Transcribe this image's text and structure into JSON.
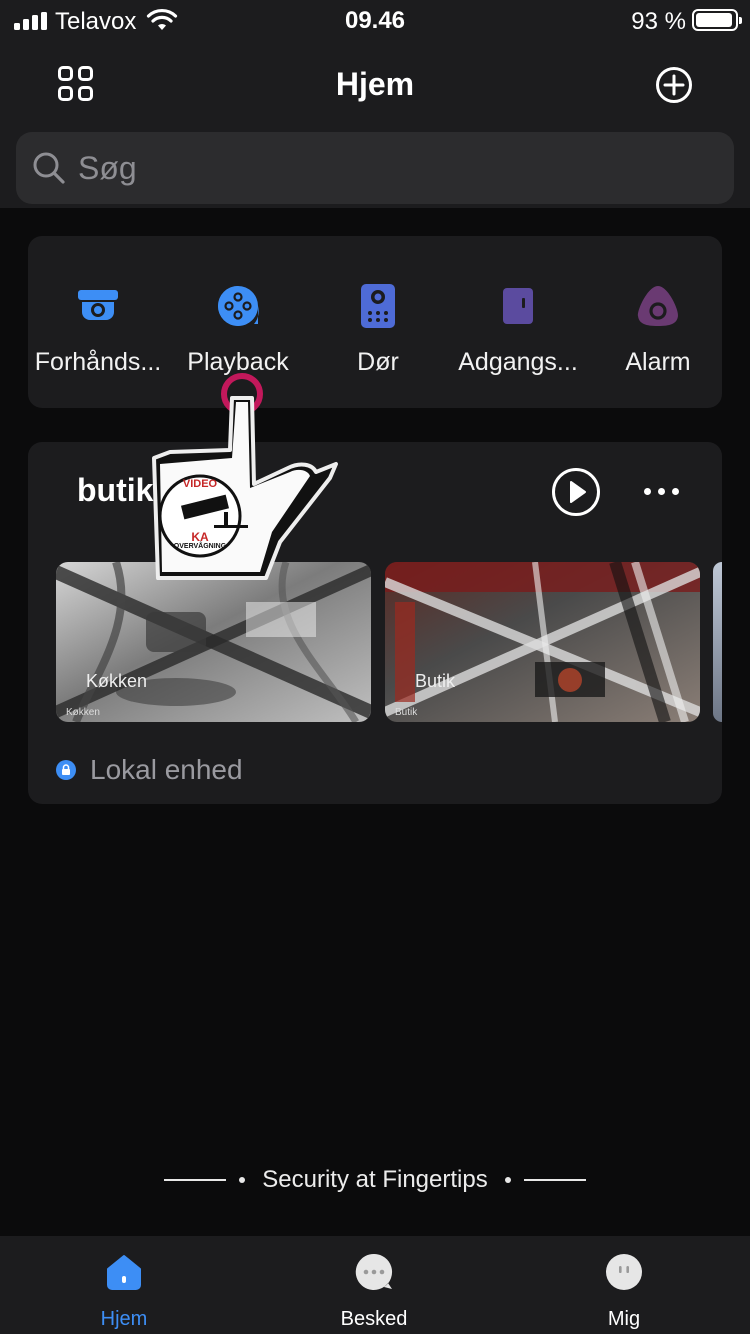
{
  "status_bar": {
    "carrier": "Telavox",
    "time": "09.46",
    "battery": "93 %",
    "battery_level": 0.93
  },
  "header": {
    "title": "Hjem",
    "left_icon": "grid-icon",
    "right_icon": "add-circle-icon"
  },
  "search": {
    "placeholder": "Søg",
    "value": ""
  },
  "quick_access": [
    {
      "label": "Forhånds...",
      "icon": "dome-camera-icon",
      "color": "#3d8ef5"
    },
    {
      "label": "Playback",
      "icon": "playback-icon",
      "color": "#3d8ef5"
    },
    {
      "label": "Dør",
      "icon": "door-station-icon",
      "color": "#4e6bd6"
    },
    {
      "label": "Adgangs...",
      "icon": "access-control-icon",
      "color": "#5b4b9f"
    },
    {
      "label": "Alarm",
      "icon": "alarm-icon",
      "color": "#6a3a72"
    }
  ],
  "device": {
    "name": "butik",
    "play_icon": "play-circle-icon",
    "more_icon": "more-dots-icon",
    "cameras": [
      {
        "label": "Køkken"
      },
      {
        "label": "Butik"
      }
    ],
    "status": "Lokal enhed"
  },
  "overlay": {
    "sign_top": "VIDEO",
    "sign_mid": "KA",
    "sign_bottom": "OVERVÅGNING"
  },
  "tagline": "Security at Fingertips",
  "tabs": [
    {
      "label": "Hjem",
      "icon": "home-icon",
      "active": true
    },
    {
      "label": "Besked",
      "icon": "message-icon",
      "active": false
    },
    {
      "label": "Mig",
      "icon": "profile-icon",
      "active": false
    }
  ],
  "colors": {
    "accent": "#3d8ef5",
    "background": "#0b0b0c",
    "card": "#1c1c1e"
  }
}
